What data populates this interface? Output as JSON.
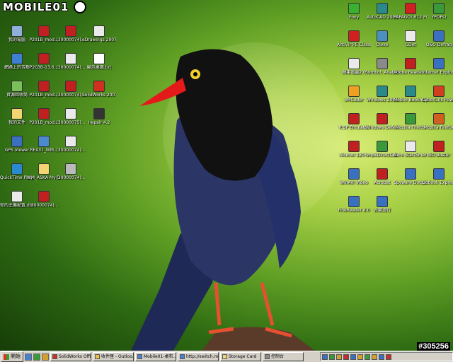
{
  "watermark": {
    "brand": "MOBILE01",
    "id": "#305256"
  },
  "colors": {
    "desktop_green": "#6aa32a",
    "bird_blue": "#2b3566",
    "bird_black": "#111111",
    "beak_red": "#e41a1a",
    "taskbar": "#d4d0c8"
  },
  "desktop": {
    "left_icons": [
      {
        "label": "我的電腦",
        "icon": "computer-icon",
        "color": "#8fb0d8"
      },
      {
        "label": "網路上的芳鄰",
        "icon": "network-icon",
        "color": "#3d7fd0"
      },
      {
        "label": "資源回收筒",
        "icon": "recycle-bin-icon",
        "color": "#7bbf5a"
      },
      {
        "label": "我的文件",
        "icon": "folder-icon",
        "color": "#f2d470"
      },
      {
        "label": "GPS Viewer",
        "icon": "globe-icon",
        "color": "#3a70c0"
      },
      {
        "label": "QuickTime Player",
        "icon": "quicktime-icon",
        "color": "#2a8ad0"
      },
      {
        "label": "你的主機配置.doc",
        "icon": "document-icon",
        "color": "#eaeaea"
      }
    ],
    "col2_icons": [
      {
        "label": "P201B_mod...",
        "icon": "pdf-icon",
        "color": "#c02020"
      },
      {
        "label": "P203B-13.6...",
        "icon": "pdf-icon",
        "color": "#c02020"
      },
      {
        "label": "P201B_mod...",
        "icon": "pdf-icon",
        "color": "#c02020"
      },
      {
        "label": "P201B_mod...",
        "icon": "pdf-icon",
        "color": "#c02020"
      },
      {
        "label": "REX31_WM...",
        "icon": "app-icon",
        "color": "#4c8ad0"
      },
      {
        "label": "WM_ASKA My Documents",
        "icon": "folder-icon",
        "color": "#f2d470"
      },
      {
        "label": "(30000074)...",
        "icon": "pdf-icon",
        "color": "#c02020"
      }
    ],
    "col3_icons": [
      {
        "label": "(30000074)...",
        "icon": "pdf-icon",
        "color": "#c02020"
      },
      {
        "label": "(30000074)...",
        "icon": "document-icon",
        "color": "#eaeaea"
      },
      {
        "label": "(30000074)...",
        "icon": "pdf-icon",
        "color": "#c02020"
      },
      {
        "label": "(30000075)...",
        "icon": "document-icon",
        "color": "#eaeaea"
      },
      {
        "label": "(30000074)...",
        "icon": "document-icon",
        "color": "#eaeaea"
      },
      {
        "label": "(30000074)...",
        "icon": "image-icon",
        "color": "#bbbbbb"
      }
    ],
    "col4_icons": [
      {
        "label": "eDrawings 2007",
        "icon": "edrawings-icon",
        "color": "#eaeaea"
      },
      {
        "label": "顯示桌面.txt",
        "icon": "text-file-icon",
        "color": "#ffffff"
      },
      {
        "label": "SolidWorks 2007 SP0.0",
        "icon": "solidworks-icon",
        "color": "#d03020"
      },
      {
        "label": "Irepair 4.2",
        "icon": "app-icon",
        "color": "#333333"
      }
    ],
    "right_col1": [
      {
        "label": "Foxy",
        "icon": "foxy-icon",
        "color": "#3ab030"
      },
      {
        "label": "AntiVir PE Classic",
        "icon": "antivirus-icon",
        "color": "#d02020"
      },
      {
        "label": "蘋果電腦2.0",
        "icon": "document-icon",
        "color": "#eaeaea"
      },
      {
        "label": "eMCoder",
        "icon": "app-icon",
        "color": "#f0a020"
      },
      {
        "label": "R:SP Emulator",
        "icon": "car-icon",
        "color": "#c02020"
      },
      {
        "label": "Alcohol 120%",
        "icon": "alcohol-icon",
        "color": "#c02020"
      },
      {
        "label": "WinAVI Video",
        "icon": "app-icon",
        "color": "#3a70c0"
      },
      {
        "label": "FineReader 8.0",
        "icon": "app-icon",
        "color": "#3a70c0"
      }
    ],
    "right_col2": [
      {
        "label": "AutoCAD 2006",
        "icon": "autocad-icon",
        "color": "#2a8a8a"
      },
      {
        "label": "Divxe",
        "icon": "app-icon",
        "color": "#4a90c0"
      },
      {
        "label": "Symbol: Anatolia",
        "icon": "app-icon",
        "color": "#8a8a8a"
      },
      {
        "label": "Windows 2006",
        "icon": "app-icon",
        "color": "#2a8a8a"
      },
      {
        "label": "Windows Defender",
        "icon": "shield-icon",
        "color": "#c02020"
      },
      {
        "label": "mp3DirectCut",
        "icon": "app-icon",
        "color": "#3a9a3a"
      },
      {
        "label": "Acrobat",
        "icon": "app-icon",
        "color": "#c02020"
      },
      {
        "label": "古樂流行",
        "icon": "app-icon",
        "color": "#3a70c0"
      }
    ],
    "right_col3": [
      {
        "label": "PAPAGO! R12 PC版",
        "icon": "papago-icon",
        "color": "#d02020"
      },
      {
        "label": "GDet",
        "icon": "app-icon",
        "color": "#eaeaea"
      },
      {
        "label": "Adobe Reader 7.0",
        "icon": "adobe-icon",
        "color": "#c02020"
      },
      {
        "label": "Mobile Bookmarks",
        "icon": "app-icon",
        "color": "#2a8a8a"
      },
      {
        "label": "Mozilla Firefox",
        "icon": "app-icon",
        "color": "#3a9a3a"
      },
      {
        "label": "Nero StartSmart",
        "icon": "app-icon",
        "color": "#eaeaea"
      },
      {
        "label": "Spyware Doctor",
        "icon": "app-icon",
        "color": "#3a70c0"
      }
    ],
    "right_col4": [
      {
        "label": "YPOPs!",
        "icon": "app-icon",
        "color": "#3a9a3a"
      },
      {
        "label": "O&O Defrag",
        "icon": "app-icon",
        "color": "#3a70c0"
      },
      {
        "label": "Internet Explorer",
        "icon": "ie-icon",
        "color": "#3a70c0"
      },
      {
        "label": "CyberLink PowerDVD",
        "icon": "dvd-icon",
        "color": "#d04020"
      },
      {
        "label": "Mozilla Firefox",
        "icon": "firefox-icon",
        "color": "#d06020"
      },
      {
        "label": "ISO Buster",
        "icon": "app-icon",
        "color": "#c02020"
      },
      {
        "label": "Outlook Express",
        "icon": "app-icon",
        "color": "#3a70c0"
      }
    ]
  },
  "taskbar": {
    "start_label": "開始",
    "tasks": [
      {
        "label": "SolidWorks Offi...",
        "icon": "solidworks-icon"
      },
      {
        "label": "收件匣 - Outloo...",
        "icon": "mail-icon"
      },
      {
        "label": "Mobile01-桌布...",
        "icon": "browser-icon"
      },
      {
        "label": "http://switch.mobi...",
        "icon": "browser-icon"
      },
      {
        "label": "Storage Card",
        "icon": "folder-icon"
      },
      {
        "label": "控制台",
        "icon": "control-panel-icon"
      }
    ]
  }
}
